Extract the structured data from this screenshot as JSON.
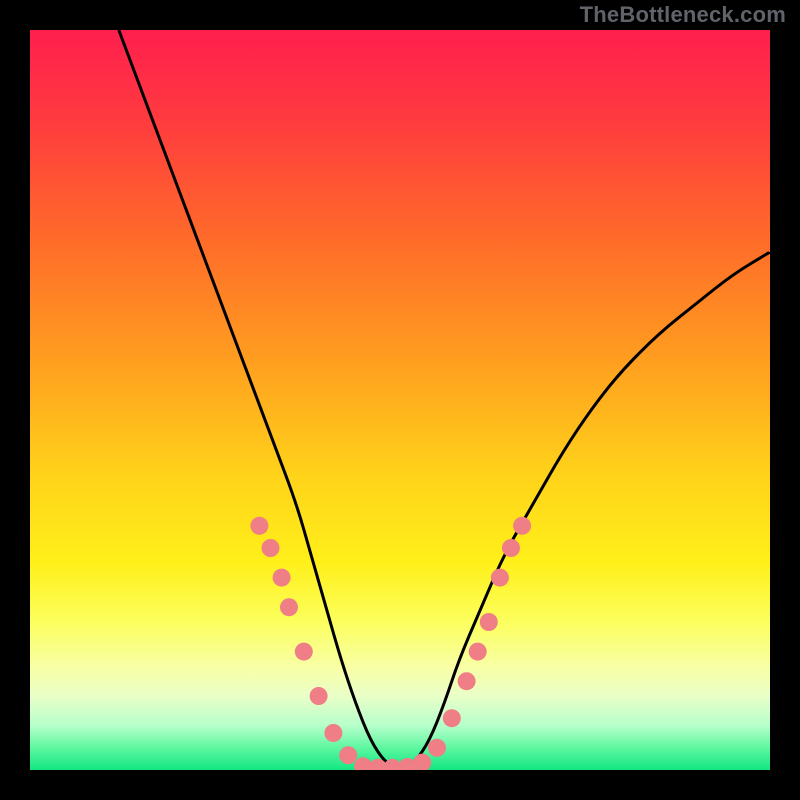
{
  "watermark": "TheBottleneck.com",
  "chart_data": {
    "type": "line",
    "title": "",
    "xlabel": "",
    "ylabel": "",
    "xlim": [
      0,
      100
    ],
    "ylim": [
      0,
      100
    ],
    "gradient_stops": [
      {
        "pos": 0.0,
        "color": "#ff1f4e"
      },
      {
        "pos": 0.12,
        "color": "#ff3a3f"
      },
      {
        "pos": 0.28,
        "color": "#ff6a2a"
      },
      {
        "pos": 0.45,
        "color": "#ff9f1f"
      },
      {
        "pos": 0.6,
        "color": "#ffd21a"
      },
      {
        "pos": 0.72,
        "color": "#fff01a"
      },
      {
        "pos": 0.8,
        "color": "#fcff5e"
      },
      {
        "pos": 0.86,
        "color": "#f8ffa4"
      },
      {
        "pos": 0.9,
        "color": "#eaffc8"
      },
      {
        "pos": 0.94,
        "color": "#b6ffcb"
      },
      {
        "pos": 0.97,
        "color": "#5ef7a0"
      },
      {
        "pos": 1.0,
        "color": "#12e783"
      }
    ],
    "series": [
      {
        "name": "bottleneck-curve",
        "x": [
          12,
          15,
          18,
          21,
          24,
          27,
          30,
          33,
          36,
          38,
          40,
          42,
          44,
          46,
          48,
          50,
          52,
          54,
          56,
          58,
          61,
          64,
          68,
          72,
          76,
          80,
          85,
          90,
          95,
          100
        ],
        "y": [
          100,
          92,
          84,
          76,
          68,
          60,
          52,
          44,
          36,
          29,
          22,
          15,
          9,
          4,
          1,
          0,
          1,
          4,
          9,
          15,
          22,
          29,
          36,
          43,
          49,
          54,
          59,
          63,
          67,
          70
        ]
      }
    ],
    "markers": {
      "name": "highlight-dots",
      "color": "#ef7e86",
      "radius": 9,
      "points": [
        {
          "x": 31,
          "y": 33
        },
        {
          "x": 32.5,
          "y": 30
        },
        {
          "x": 34,
          "y": 26
        },
        {
          "x": 35,
          "y": 22
        },
        {
          "x": 37,
          "y": 16
        },
        {
          "x": 39,
          "y": 10
        },
        {
          "x": 41,
          "y": 5
        },
        {
          "x": 43,
          "y": 2
        },
        {
          "x": 45,
          "y": 0.5
        },
        {
          "x": 47,
          "y": 0.3
        },
        {
          "x": 49,
          "y": 0.3
        },
        {
          "x": 51,
          "y": 0.4
        },
        {
          "x": 53,
          "y": 1
        },
        {
          "x": 55,
          "y": 3
        },
        {
          "x": 57,
          "y": 7
        },
        {
          "x": 59,
          "y": 12
        },
        {
          "x": 60.5,
          "y": 16
        },
        {
          "x": 62,
          "y": 20
        },
        {
          "x": 63.5,
          "y": 26
        },
        {
          "x": 65,
          "y": 30
        },
        {
          "x": 66.5,
          "y": 33
        }
      ]
    }
  }
}
